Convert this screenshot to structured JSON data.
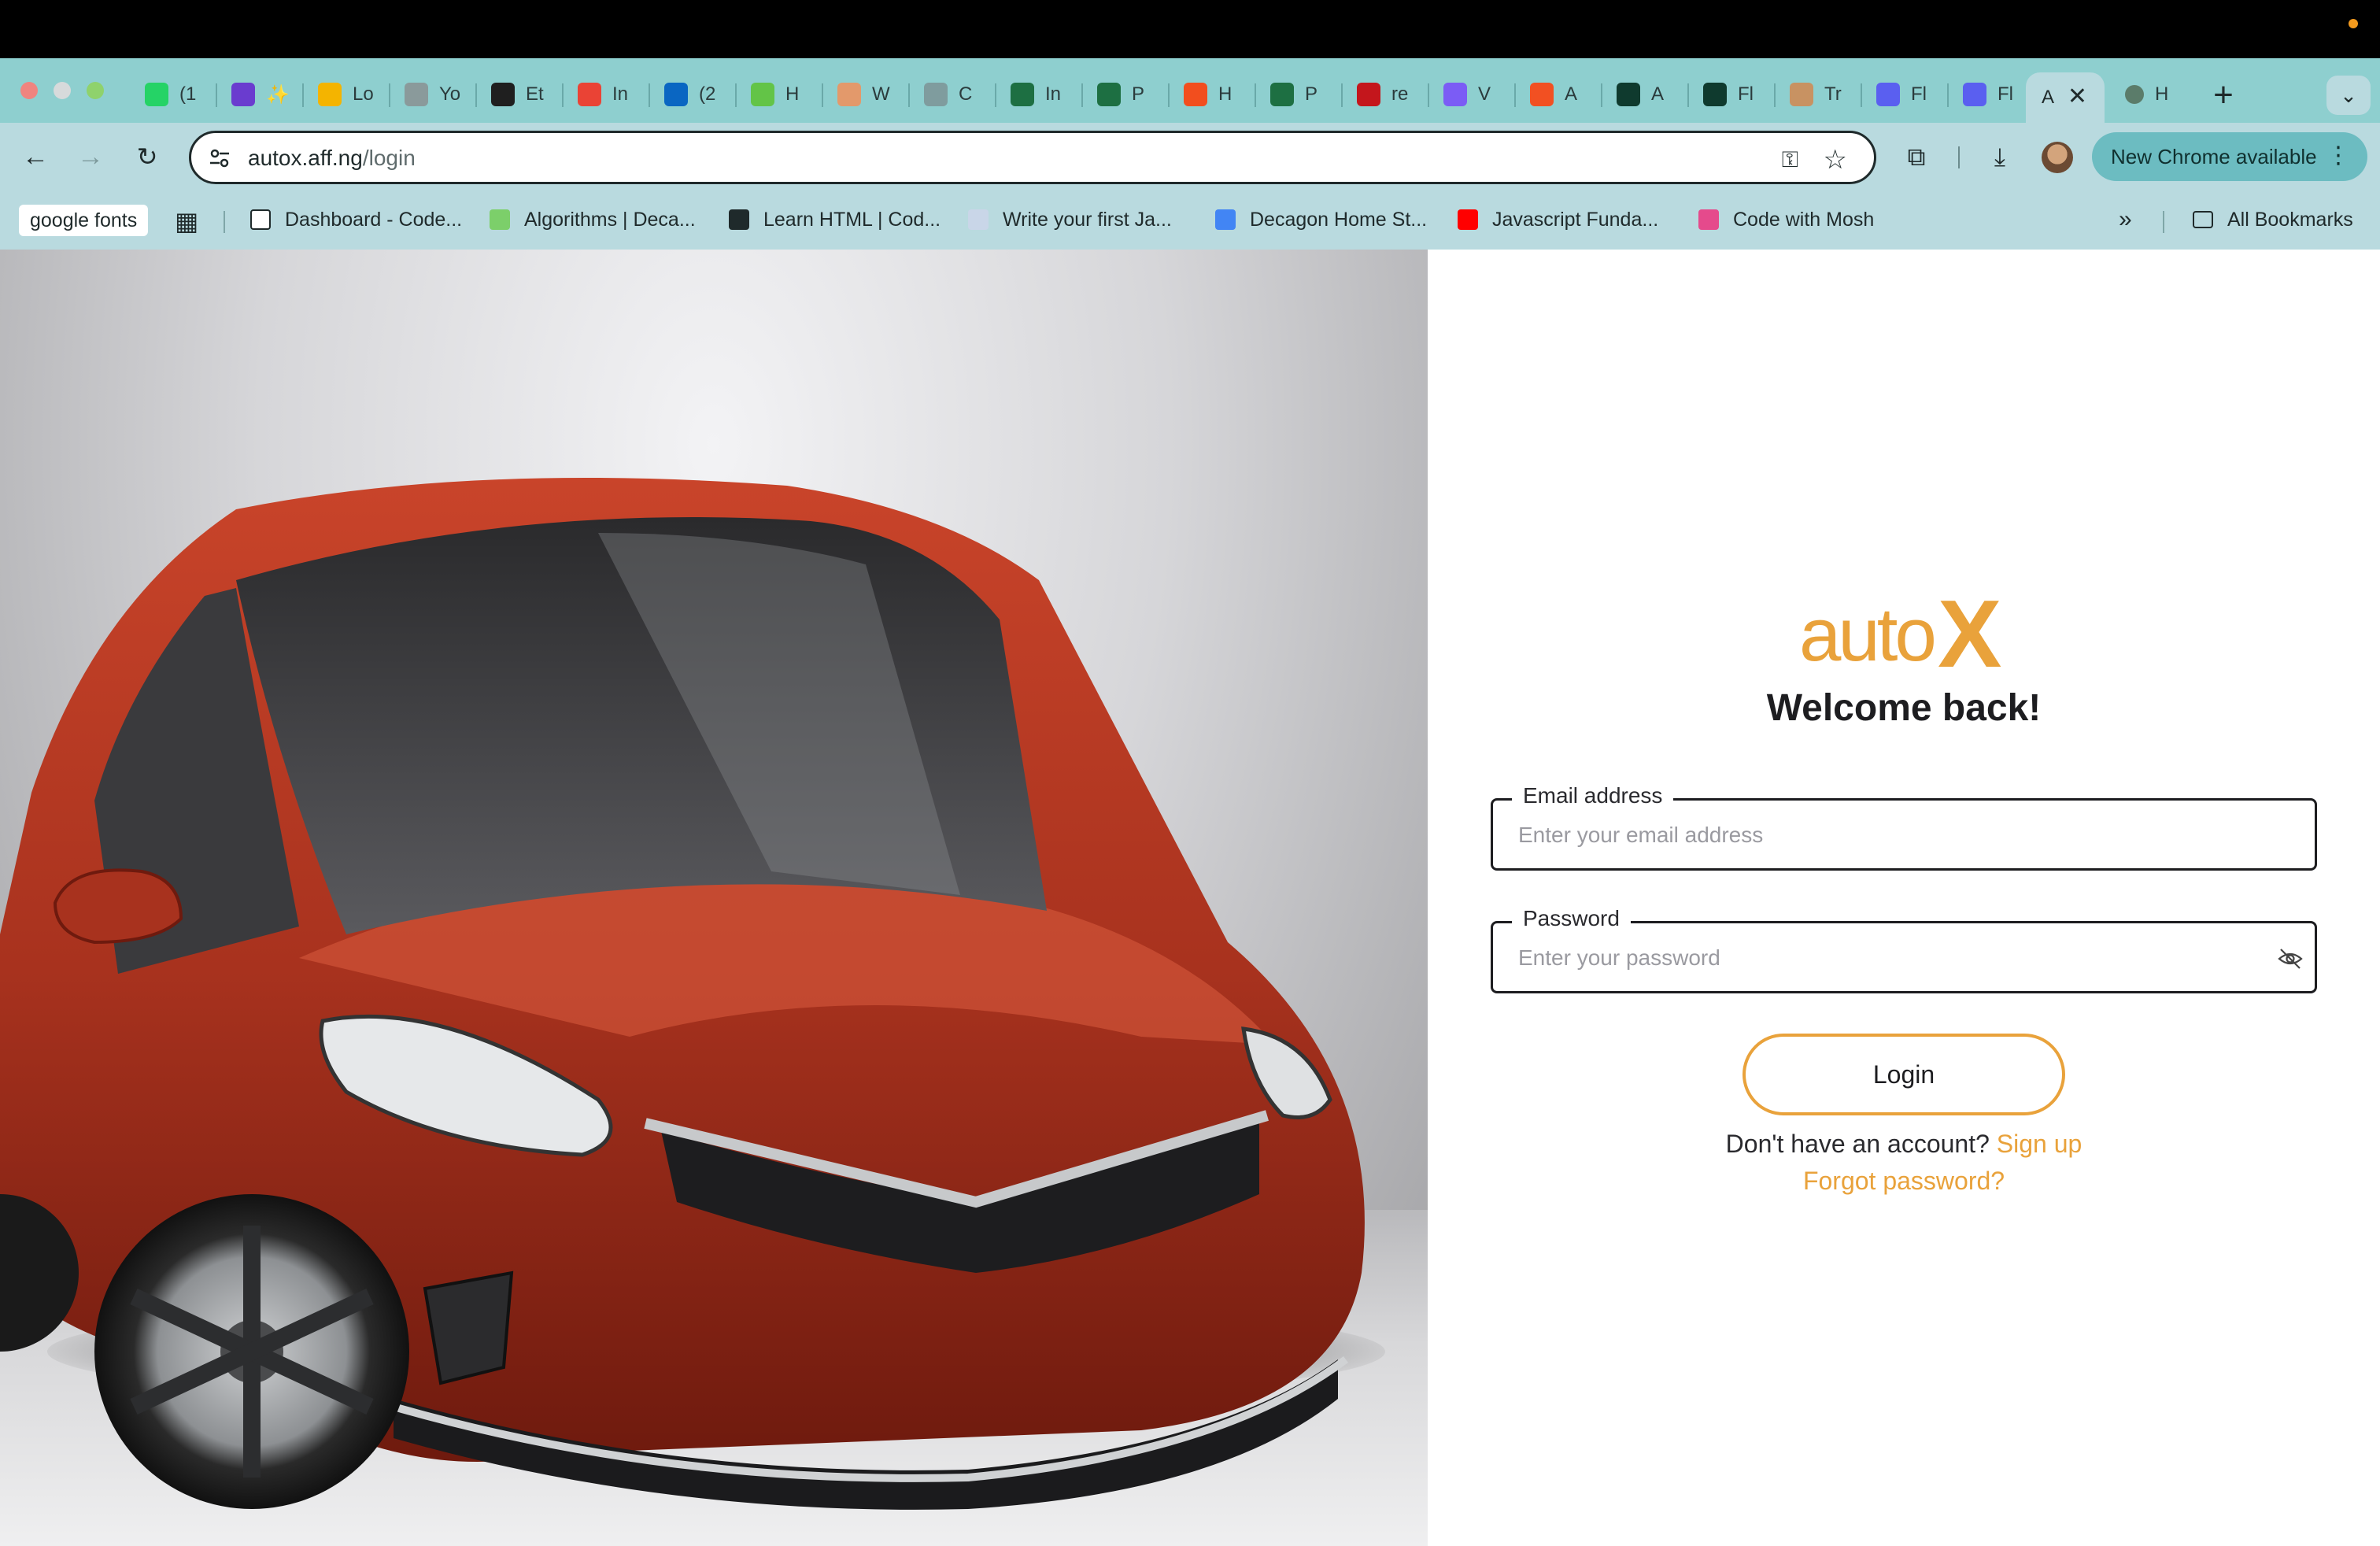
{
  "browser": {
    "tabs": [
      {
        "title": "(1",
        "color": "#25d366",
        "icon": "whatsapp-icon"
      },
      {
        "title": "✨",
        "color": "#6a3ccf",
        "icon": "list-icon"
      },
      {
        "title": "Lo",
        "color": "#f4b400",
        "icon": "drive-icon"
      },
      {
        "title": "Yo",
        "color": "#8a9a9b",
        "icon": "globe-icon"
      },
      {
        "title": "Et",
        "color": "#1f1f1f",
        "icon": "openai-icon"
      },
      {
        "title": "In",
        "color": "#ea4335",
        "icon": "gmail-icon"
      },
      {
        "title": "(2",
        "color": "#0a66c2",
        "icon": "linkedin-icon"
      },
      {
        "title": "H",
        "color": "#63c447",
        "icon": "puzzle-icon"
      },
      {
        "title": "W",
        "color": "#e3996b",
        "icon": "pin-icon"
      },
      {
        "title": "C",
        "color": "#7f9c9e",
        "icon": "doc-icon"
      },
      {
        "title": "In",
        "color": "#1d6f42",
        "icon": "excel-icon"
      },
      {
        "title": "P",
        "color": "#1d6f42",
        "icon": "excel-icon"
      },
      {
        "title": "H",
        "color": "#f24e1e",
        "icon": "figma-icon"
      },
      {
        "title": "P",
        "color": "#1d6f42",
        "icon": "excel-icon"
      },
      {
        "title": "re",
        "color": "#c4161c",
        "icon": "n-icon"
      },
      {
        "title": "V",
        "color": "#7b5cf5",
        "icon": "vite-icon"
      },
      {
        "title": "A",
        "color": "#f25022",
        "icon": "microsoft-icon"
      },
      {
        "title": "A",
        "color": "#0f3a2e",
        "icon": "diamond-icon"
      },
      {
        "title": "Fl",
        "color": "#0f3a2e",
        "icon": "diamond-icon"
      },
      {
        "title": "Tr",
        "color": "#c89262",
        "icon": "tag-icon"
      },
      {
        "title": "Fl",
        "color": "#5a5ff0",
        "icon": "heart-icon"
      },
      {
        "title": "Fl",
        "color": "#5a5ff0",
        "icon": "heart-icon"
      }
    ],
    "active_tab": {
      "title": "A"
    },
    "last_tab": {
      "title": "H",
      "icon": "eye-icon"
    },
    "url_host": "autox.aff.ng",
    "url_path": "/login",
    "update_label": "New Chrome available",
    "bookmarks": [
      {
        "label": "google fonts"
      },
      {
        "label": "Dashboard - Code...",
        "color": "#ffffff",
        "icon": "page-icon"
      },
      {
        "label": "Algorithms | Deca...",
        "color": "#7ccf6a",
        "icon": "spinner-icon"
      },
      {
        "label": "Learn HTML | Cod...",
        "color": "#1f2a2b",
        "icon": "codecademy-icon"
      },
      {
        "label": "Write your first Ja...",
        "color": "#c9d6e8",
        "icon": "cloud-icon"
      },
      {
        "label": "Decagon Home St...",
        "color": "#4285f4",
        "icon": "docs-icon"
      },
      {
        "label": "Javascript Funda...",
        "color": "#ff0000",
        "icon": "youtube-icon"
      },
      {
        "label": "Code with Mosh",
        "color": "#e54a8c",
        "icon": "mosh-icon"
      }
    ],
    "all_bookmarks_label": "All Bookmarks"
  },
  "login": {
    "logo_text": "auto",
    "logo_mark": "X",
    "brand_color": "#e9a23b",
    "heading": "Welcome back!",
    "email_label": "Email address",
    "email_placeholder": "Enter your email address",
    "password_label": "Password",
    "password_placeholder": "Enter your password",
    "login_button": "Login",
    "no_account_text": "Don't have an account?",
    "signup_link": "Sign up",
    "forgot_link": "Forgot password?"
  },
  "hero": {
    "car_color": "#a8321e",
    "image": "red-hatchback-car"
  }
}
